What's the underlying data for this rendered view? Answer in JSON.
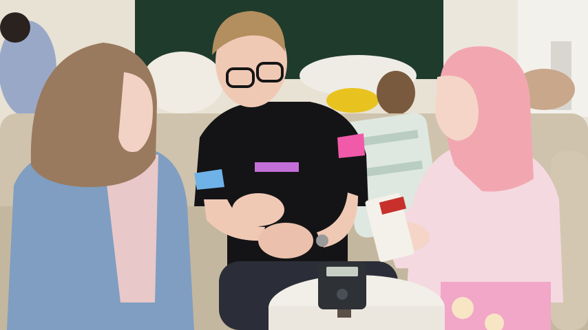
{
  "scene": {
    "shirt_print": {
      "left_graphic": "",
      "center_graphic": "",
      "sleeve_graphic": ""
    },
    "box_label": {
      "line1": "",
      "line2": ""
    },
    "recorder_screen": ""
  },
  "colors": {
    "back_wall": "#e8e2d4",
    "green_board": "#1f3b2c",
    "sofa": "#cfc3ad",
    "cushion_pattern": "#dfe8e0",
    "denim": "#7f9ec2",
    "black_tshirt": "#141416",
    "pink_hair": "#f2a7b0",
    "pink_sweater": "#f4d9e0",
    "table_top": "#f2efe8"
  }
}
